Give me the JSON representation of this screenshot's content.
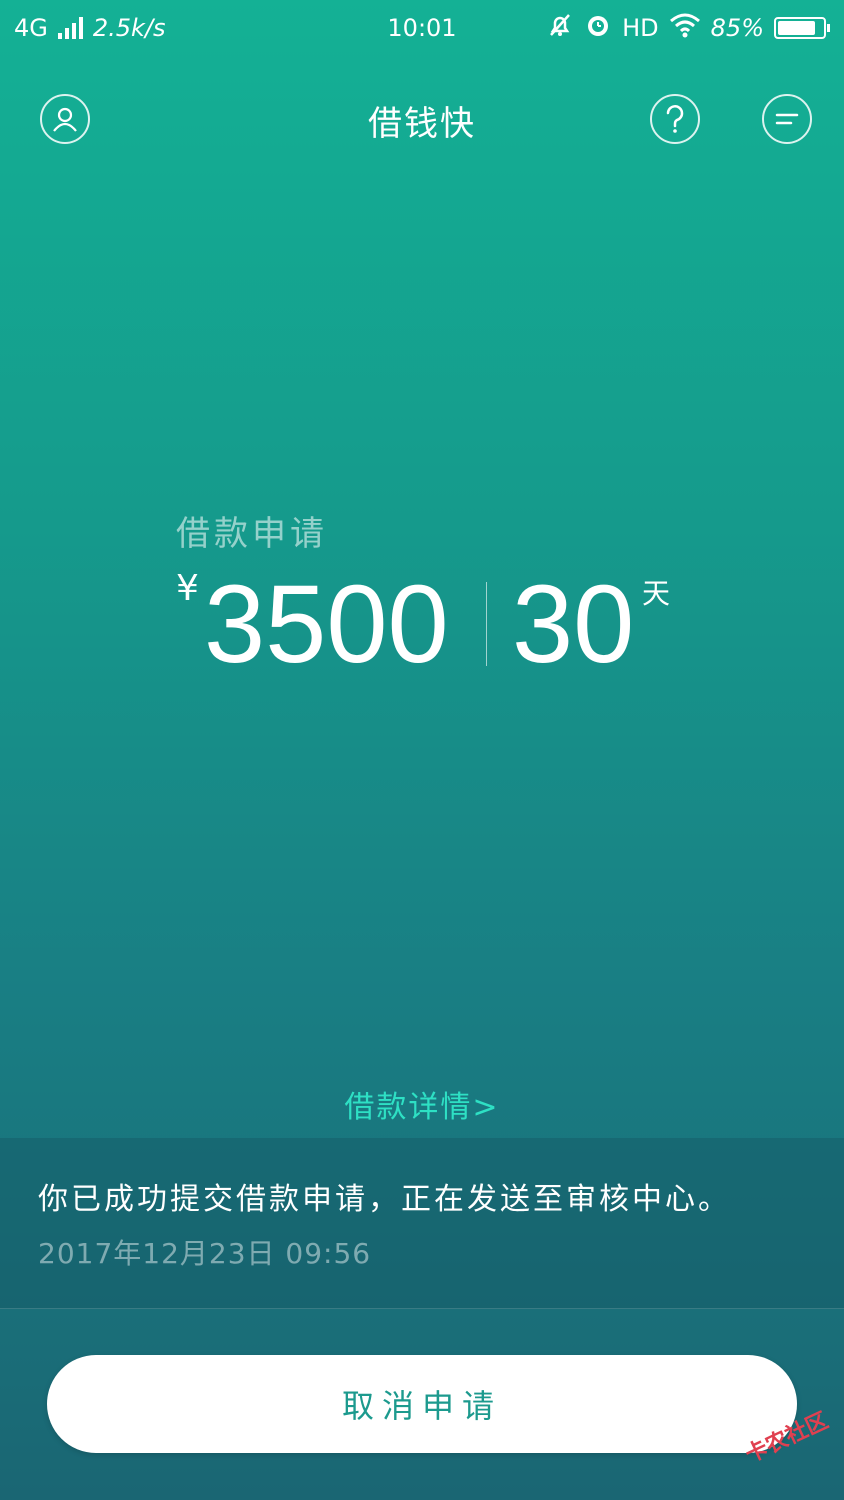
{
  "status_bar": {
    "network": "4G",
    "speed": "2.5k/s",
    "time": "10:01",
    "hd": "HD",
    "battery": "85%"
  },
  "header": {
    "title": "借钱快"
  },
  "loan": {
    "label": "借款申请",
    "currency": "¥",
    "amount": "3500",
    "days": "30",
    "days_unit": "天"
  },
  "detail_link": "借款详情>",
  "notice": {
    "message": "你已成功提交借款申请，正在发送至审核中心。",
    "timestamp": "2017年12月23日  09:56"
  },
  "cancel_button": "取消申请",
  "watermark": "卡农社区",
  "colors": {
    "accent": "#2ee0c4",
    "button_text": "#1c9a8e"
  }
}
